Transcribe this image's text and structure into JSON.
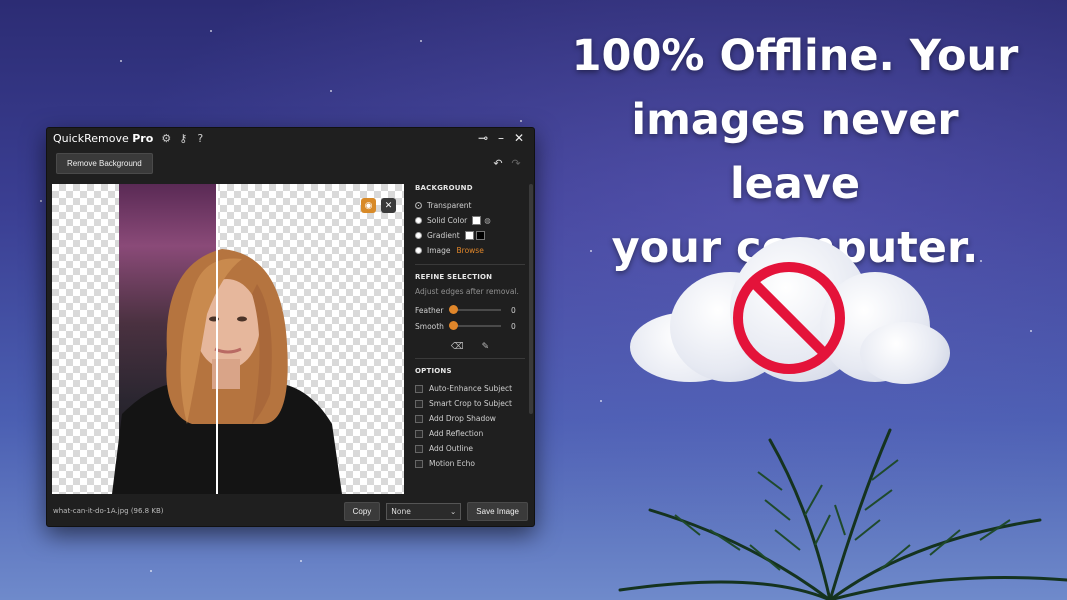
{
  "headline": {
    "line1": "100% Offline. Your",
    "line2": "images never leave",
    "line3": "your computer."
  },
  "app": {
    "title_main": "QuickRemove",
    "title_bold": "Pro",
    "toolbar": {
      "remove_background_label": "Remove Background"
    },
    "background": {
      "title": "BACKGROUND",
      "options": [
        "Transparent",
        "Solid Color",
        "Gradient",
        "Image"
      ],
      "selected": "Transparent",
      "browse_label": "Browse"
    },
    "refine": {
      "title": "REFINE SELECTION",
      "hint": "Adjust edges after removal.",
      "feather_label": "Feather",
      "feather_value": "0",
      "smooth_label": "Smooth",
      "smooth_value": "0"
    },
    "options": {
      "title": "OPTIONS",
      "items": [
        "Auto-Enhance Subject",
        "Smart Crop to Subject",
        "Add Drop Shadow",
        "Add Reflection",
        "Add Outline",
        "Motion Echo"
      ]
    },
    "status": {
      "filename": "what-can-it-do-1A.jpg (96.8 KB)",
      "copy_label": "Copy",
      "select_value": "None",
      "save_label": "Save Image"
    }
  },
  "colors": {
    "accent_orange": "#e0862a",
    "no_sign_red": "#e4133a",
    "window_bg": "#1f1f1f"
  }
}
